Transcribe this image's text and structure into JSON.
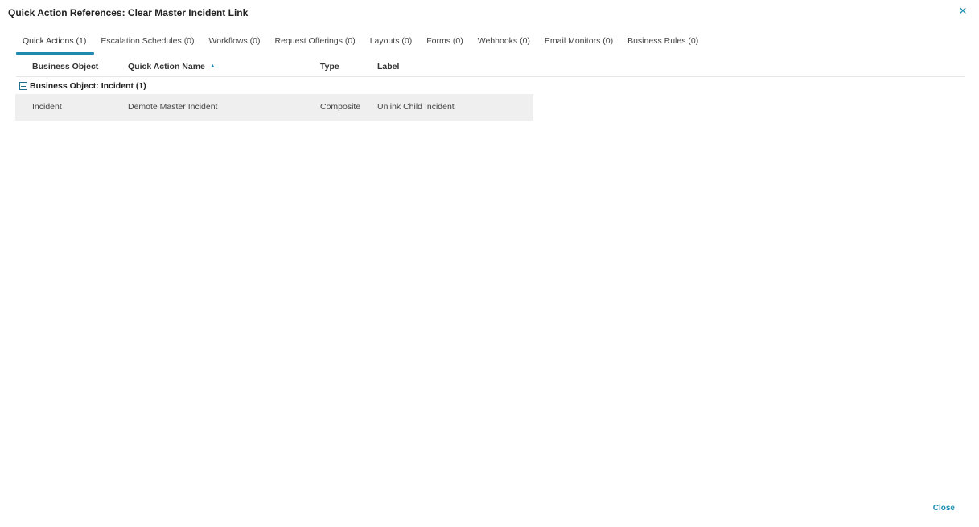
{
  "dialog": {
    "title": "Quick Action References: Clear Master Incident Link",
    "close_glyph": "✕",
    "footer_close_label": "Close"
  },
  "tabs": [
    {
      "label": "Quick Actions (1)",
      "active": true
    },
    {
      "label": "Escalation Schedules (0)",
      "active": false
    },
    {
      "label": "Workflows (0)",
      "active": false
    },
    {
      "label": "Request Offerings (0)",
      "active": false
    },
    {
      "label": "Layouts (0)",
      "active": false
    },
    {
      "label": "Forms (0)",
      "active": false
    },
    {
      "label": "Webhooks (0)",
      "active": false
    },
    {
      "label": "Email Monitors (0)",
      "active": false
    },
    {
      "label": "Business Rules (0)",
      "active": false
    }
  ],
  "grid": {
    "columns": [
      "Business Object",
      "Quick Action Name",
      "Type",
      "Label"
    ],
    "sort_column": "Quick Action Name",
    "sort_direction": "ascending",
    "sort_icon": "sort-ascending-icon",
    "groups": [
      {
        "label": "Business Object: Incident (1)",
        "expanded": true,
        "icon": "collapse-minus-icon",
        "rows": [
          [
            "Incident",
            "Demote Master Incident",
            "Composite",
            "Unlink Child Incident"
          ]
        ]
      }
    ]
  },
  "colors": {
    "accent": "#1f8aad",
    "row_background": "#efefef",
    "text": "#333333"
  }
}
